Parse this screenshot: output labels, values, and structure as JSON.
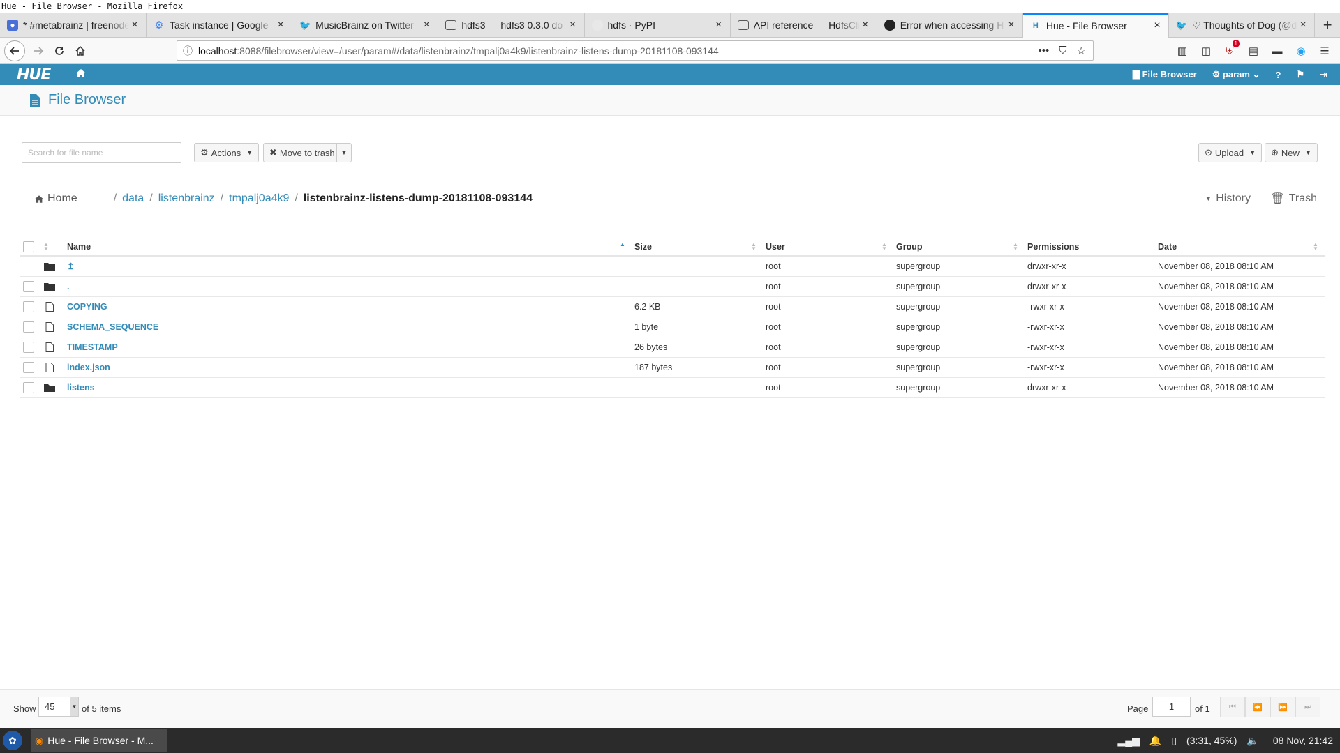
{
  "window": {
    "title": "Hue - File Browser - Mozilla Firefox"
  },
  "tabs": [
    {
      "title": "* #metabrainz | freenode",
      "icon": "chat-icon",
      "color": "#4a6fd6"
    },
    {
      "title": "Task instance | Google",
      "icon": "gear-icon",
      "color": "#4285f4"
    },
    {
      "title": "MusicBrainz on Twitter",
      "icon": "twitter-icon",
      "color": "#1da1f2"
    },
    {
      "title": "hdfs3 — hdfs3 0.3.0 do",
      "icon": "doc-icon",
      "color": "#555555"
    },
    {
      "title": "hdfs · PyPI",
      "icon": "box-icon",
      "color": "#cccccc"
    },
    {
      "title": "API reference — HdfsCli",
      "icon": "doc-icon",
      "color": "#555555"
    },
    {
      "title": "Error when accessing H",
      "icon": "github-icon",
      "color": "#222222"
    },
    {
      "title": "Hue - File Browser",
      "icon": "hue-icon",
      "color": "#338bb8",
      "active": true
    },
    {
      "title": "♡ Thoughts of Dog (@d",
      "icon": "twitter-icon",
      "color": "#1da1f2"
    }
  ],
  "url": {
    "host": "localhost",
    "path": ":8088/filebrowser/view=/user/param#/data/listenbrainz/tmpalj0a4k9/listenbrainz-listens-dump-20181108-093144"
  },
  "hue": {
    "logo": "HUE",
    "file_browser": "File Browser",
    "user": "param"
  },
  "page": {
    "title": "File Browser"
  },
  "toolbar": {
    "search_placeholder": "Search for file name",
    "actions": "Actions",
    "move_to_trash": "Move to trash",
    "upload": "Upload",
    "new": "New"
  },
  "breadcrumb": {
    "home": "Home",
    "parts": [
      "data",
      "listenbrainz",
      "tmpalj0a4k9"
    ],
    "current": "listenbrainz-listens-dump-20181108-093144",
    "history": "History",
    "trash": "Trash"
  },
  "table": {
    "columns": [
      "Name",
      "Size",
      "User",
      "Group",
      "Permissions",
      "Date"
    ],
    "rows": [
      {
        "type": "folder",
        "name": "↥",
        "size": "",
        "user": "root",
        "group": "supergroup",
        "perms": "drwxr-xr-x",
        "date": "November 08, 2018 08:10 AM"
      },
      {
        "type": "folder",
        "name": ".",
        "size": "",
        "user": "root",
        "group": "supergroup",
        "perms": "drwxr-xr-x",
        "date": "November 08, 2018 08:10 AM"
      },
      {
        "type": "file",
        "name": "COPYING",
        "size": "6.2 KB",
        "user": "root",
        "group": "supergroup",
        "perms": "-rwxr-xr-x",
        "date": "November 08, 2018 08:10 AM"
      },
      {
        "type": "file",
        "name": "SCHEMA_SEQUENCE",
        "size": "1 byte",
        "user": "root",
        "group": "supergroup",
        "perms": "-rwxr-xr-x",
        "date": "November 08, 2018 08:10 AM"
      },
      {
        "type": "file",
        "name": "TIMESTAMP",
        "size": "26 bytes",
        "user": "root",
        "group": "supergroup",
        "perms": "-rwxr-xr-x",
        "date": "November 08, 2018 08:10 AM"
      },
      {
        "type": "file",
        "name": "index.json",
        "size": "187 bytes",
        "user": "root",
        "group": "supergroup",
        "perms": "-rwxr-xr-x",
        "date": "November 08, 2018 08:10 AM"
      },
      {
        "type": "folder",
        "name": "listens",
        "size": "",
        "user": "root",
        "group": "supergroup",
        "perms": "drwxr-xr-x",
        "date": "November 08, 2018 08:10 AM"
      }
    ]
  },
  "pager": {
    "show_label": "Show",
    "page_size": "45",
    "of_items": "of 5 items",
    "page_label": "Page",
    "page": "1",
    "of_pages": "of 1"
  },
  "taskbar": {
    "app": "Hue - File Browser - M...",
    "battery": "(3:31, 45%)",
    "clock": "08 Nov, 21:42",
    "ublock_badge": "1"
  }
}
